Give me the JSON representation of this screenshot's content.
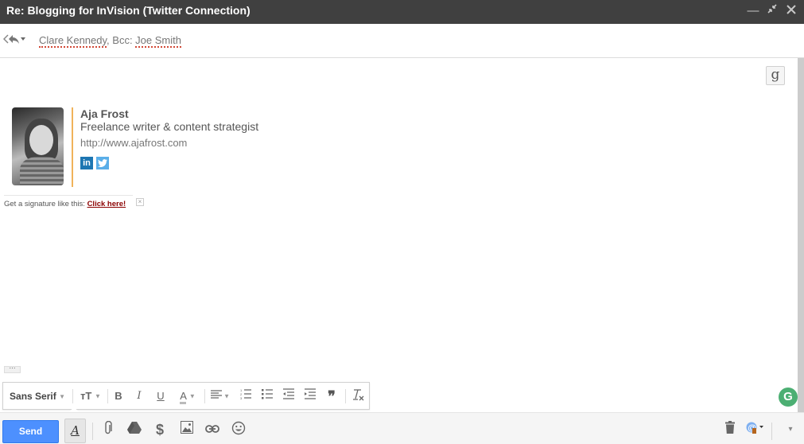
{
  "window": {
    "title": "Re: Blogging for InVision (Twitter Connection)",
    "controls": {
      "minimize": "_",
      "popout": "⤡",
      "close": "✕"
    }
  },
  "recipients": {
    "reply_icon": "reply-all-icon",
    "to": "Clare Kennedy",
    "bcc_label": ", Bcc: ",
    "bcc": "Joe Smith"
  },
  "gbutton": "g",
  "signature": {
    "name": "Aja Frost",
    "role": "Freelance writer & content strategist",
    "url": "http://www.ajafrost.com",
    "linkedin": "in",
    "twitter": "t",
    "accent_color": "#f0b35a"
  },
  "promo": {
    "text": "Get a signature like this: ",
    "link": "Click here!",
    "close": "×"
  },
  "more_button": "···",
  "format_toolbar": {
    "font": "Sans Serif",
    "size_icon": "ᴛT",
    "bold": "B",
    "italic": "I",
    "underline": "U",
    "text_color": "A",
    "align": "≡",
    "numbered_list": "⒈",
    "bulleted_list": "☰",
    "indent_less": "⇤",
    "indent_more": "⇥",
    "quote": "❞",
    "clear_format": "T̸"
  },
  "bottom_toolbar": {
    "send": "Send",
    "format_toggle": "A",
    "attach": "📎",
    "drive": "▲",
    "money": "$",
    "photo": "▣",
    "link": "⊂⊃",
    "emoji": "☺",
    "trash": "🗑",
    "more": "▾"
  },
  "grammarly": "G",
  "colors": {
    "send": "#4d90fe",
    "titlebar": "#404040",
    "grammarly": "#4caf73"
  }
}
